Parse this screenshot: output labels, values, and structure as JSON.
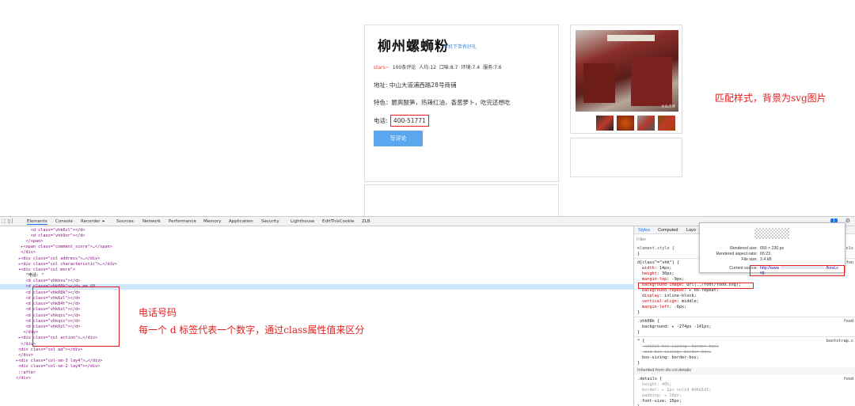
{
  "shop": {
    "title": "柳州螺蛳粉",
    "mobile_link": "手机下单有好礼",
    "stars": "stars~",
    "reviews": "100条评论",
    "avg_price": "人均:12",
    "taste": "口味:8.7",
    "environment": "环境:7.4",
    "service": "服务:7.6",
    "address": "地址: 中山大道浦西路28号商铺",
    "feature": "特色：脆爽酸笋，热辣红油，香葱萝卜，吃完还想吃",
    "phone_label": "电话:",
    "phone_value": "400-51771",
    "review_button": "写评论",
    "photo_watermark": "大众点评"
  },
  "devtools": {
    "tabs": [
      "Elements",
      "Console",
      "Recorder ⏶",
      "Sources",
      "Network",
      "Performance",
      "Memory",
      "Application",
      "Security",
      "Lighthouse",
      "EditThisCookie",
      "ZLB"
    ],
    "active_tab": "Elements",
    "issues_count": "1",
    "dom_lines": [
      "      <d class=\"vhk6zl\"></d>",
      "      <d class=\"vhk9or\"></d>",
      "    </span>",
      "  ▸<span class=\"comment_score\">…</span>",
      "  </div>",
      " ▸<div class=\"col address\">…</div>",
      " ▸<div class=\"col characteristic\">…</div>",
      " ▾<div class=\"col more\">",
      "    \"电话: \"",
      "    <d class=\"vhkbvu\"></d>",
      "    <d class=\"vhk08k\"></d> == $0",
      "    <d class=\"vhk08k\"></d>",
      "    <d class=\"vhk6zl\"></d>",
      "    <d class=\"vhk84t\"></d>",
      "    <d class=\"vhk6zl\"></d>",
      "    <d class=\"vhkqsc\"></d>",
      "    <d class=\"vhkqsc\"></d>",
      "    <d class=\"vhk6zl\"></d>",
      "   </div>",
      " ▸<div class=\"col action\">…</div>",
      "  </div>",
      " <div class=\"col ad\"></div>",
      " </div>",
      "▸<div class=\"col-sm-3 lay4\">…</div>",
      " <div class=\"col-sm-2 lay4\"></div>",
      " ::after",
      "</div>"
    ],
    "annotation_phone_title": "电话号码",
    "annotation_phone_desc": "每一个 d 标签代表一个数字，通过class属性值来区分",
    "annotation_style": "匹配样式，背景为svg图片",
    "styles": {
      "tabs": [
        "Styles",
        "Computed",
        "Layo"
      ],
      "filter_placeholder": "Filter",
      "element_style": "element.style {",
      "selector1": "d[class^=\"vhk\"] {",
      "rule1": [
        {
          "prop": "width",
          "val": "14px;"
        },
        {
          "prop": "height",
          "val": "30px;"
        },
        {
          "prop": "margin-top",
          "val": "-9px;"
        },
        {
          "prop": "background-image",
          "val": "url(../font/food.svg);"
        },
        {
          "prop": "background-repeat",
          "val": "▸ no-repeat;"
        },
        {
          "prop": "display",
          "val": "inline-block;"
        },
        {
          "prop": "vertical-align",
          "val": "middle;"
        },
        {
          "prop": "margin-left",
          "val": "-6px;"
        }
      ],
      "selector2": ".vhk08k {",
      "rule2": "background: ▸ -274px -141px;",
      "src2": "food",
      "selector3": "* {",
      "src3": "bootstrap.c",
      "rule3_strike1": "-webkit-box-sizing: border-box;",
      "rule3_strike2": "-moz-box-sizing: border-box;",
      "rule3": "box-sizing: border-box;",
      "inherited": "Inherited from div.col.details",
      "selector4": ".details {",
      "src4": "food",
      "rule4": [
        "height: 40%;",
        "border: ▸ 1px solid #d6d1d1;",
        "padding: ▸ 20px;",
        "font-size: 15px;"
      ],
      "src_cls": "cls",
      "src_fon": "fon"
    },
    "tooltip": {
      "rendered_size_label": "Rendered size:",
      "rendered_size": "650 × 230 px",
      "aspect_label": "Rendered aspect ratio:",
      "aspect": "65:23",
      "file_size_label": "File size:",
      "file_size": "3.4 kB",
      "source_label": "Current source:",
      "source_prefix": "http://www",
      "source_suffix": "/food.s",
      "source_end": "vg"
    }
  },
  "colors": {
    "annotation": "#e02020",
    "primary_button": "#5aa7f0",
    "selected_row": "#cfe8fc"
  }
}
